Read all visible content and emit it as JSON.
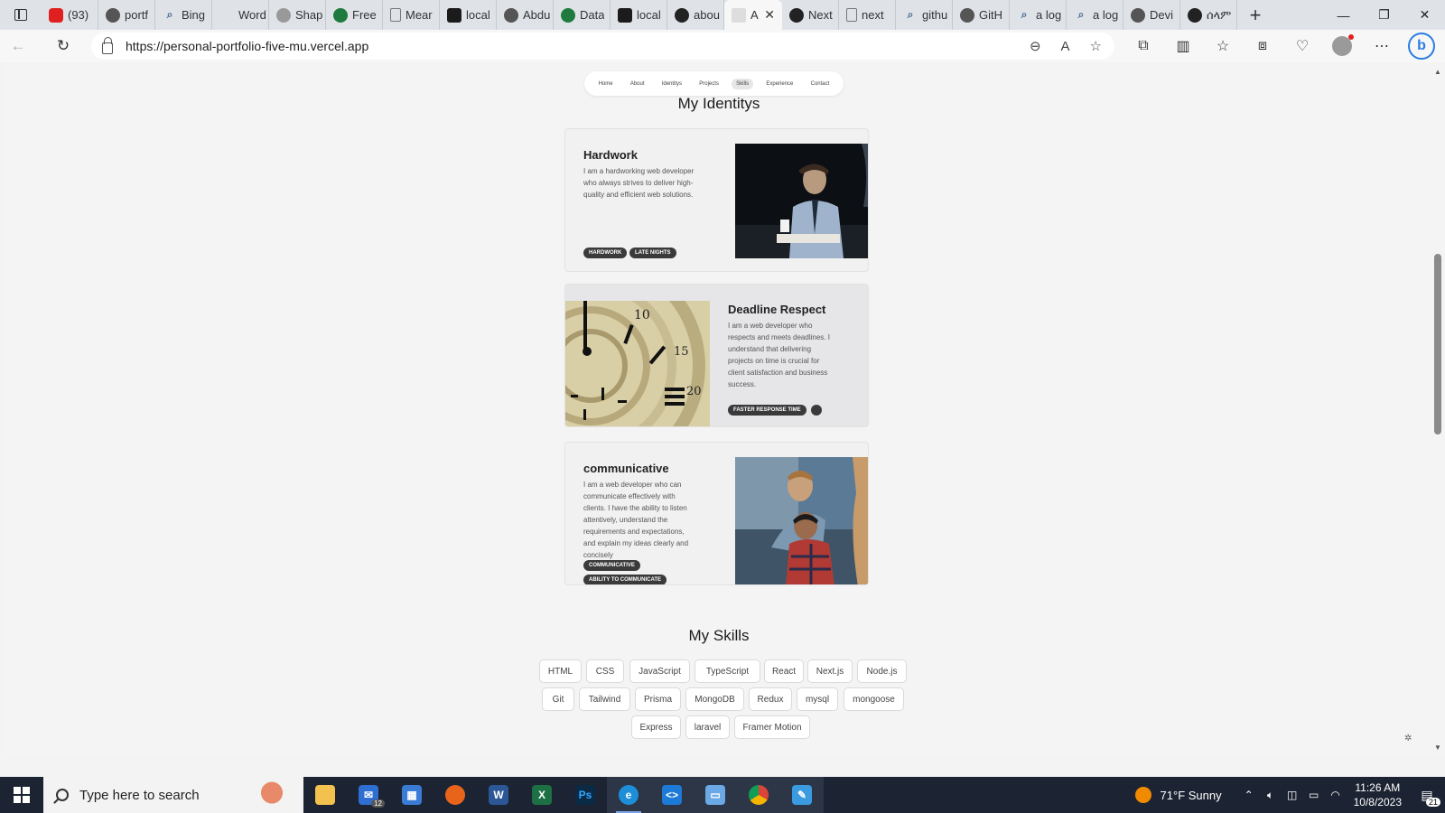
{
  "browser": {
    "tabs": [
      {
        "text": "(93)",
        "icon": "youtube-icon"
      },
      {
        "text": "portf",
        "icon": "github-icon"
      },
      {
        "text": "Bing",
        "icon": "search-icon"
      },
      {
        "text": "Word",
        "icon": "bird-icon"
      },
      {
        "text": "Shap",
        "icon": "cloud-icon"
      },
      {
        "text": "Free",
        "icon": "robot-icon"
      },
      {
        "text": "Mear",
        "icon": "document-icon"
      },
      {
        "text": "local",
        "icon": "page-icon"
      },
      {
        "text": "Abdu",
        "icon": "github-icon"
      },
      {
        "text": "Data",
        "icon": "leaf-icon"
      },
      {
        "text": "local",
        "icon": "page-icon"
      },
      {
        "text": "abou",
        "icon": "vercel-icon"
      },
      {
        "text": "A",
        "icon": "a-icon"
      },
      {
        "text": "Next",
        "icon": "nextjs-icon"
      },
      {
        "text": "next",
        "icon": "document-icon"
      },
      {
        "text": "githu",
        "icon": "search-icon"
      },
      {
        "text": "GitH",
        "icon": "github-icon"
      },
      {
        "text": "a log",
        "icon": "search-icon"
      },
      {
        "text": "a log",
        "icon": "search-icon"
      },
      {
        "text": "Devi",
        "icon": "github-icon"
      },
      {
        "text": "ሰላም",
        "icon": "vercel-icon"
      }
    ],
    "active_tab_index": 12,
    "url": "https://personal-portfolio-five-mu.vercel.app"
  },
  "page": {
    "nav": [
      "Home",
      "About",
      "Identitys",
      "Projects",
      "Skills",
      "Experience",
      "Contact"
    ],
    "active_nav": "Skills",
    "identities_title": "My Identitys",
    "identities": [
      {
        "title": "Hardwork",
        "desc_lines": [
          "I am a hardworking web developer",
          "who always strives to deliver high-",
          "quality and efficient web solutions."
        ],
        "tags": [
          "HARDWORK",
          "LATE NIGHTS"
        ]
      },
      {
        "title": "Deadline Respect",
        "desc_lines": [
          "I am a web developer who",
          "respects and meets deadlines. I",
          "understand that delivering",
          "projects on time is crucial for",
          "client satisfaction and business",
          "success."
        ],
        "tags": [
          "FASTER RESPONSE TIME"
        ]
      },
      {
        "title": "communicative",
        "desc_lines": [
          "I am a web developer who can",
          "communicate effectively with",
          "clients. I have the ability to listen",
          "attentively, understand the",
          "requirements and expectations,",
          "and explain my ideas clearly and",
          "concisely"
        ],
        "tags": [
          "COMMUNICATIVE",
          "ABILITY TO COMMUNICATE"
        ]
      }
    ],
    "skills_title": "My Skills",
    "skills": [
      "HTML",
      "CSS",
      "JavaScript",
      "TypeScript",
      "React",
      "Next.js",
      "Node.js",
      "Git",
      "Tailwind",
      "Prisma",
      "MongoDB",
      "Redux",
      "mysql",
      "mongoose",
      "Express",
      "laravel",
      "Framer Motion"
    ]
  },
  "taskbar": {
    "search_placeholder": "Type here to search",
    "mail_badge": "12",
    "weather": "71°F  Sunny",
    "time": "11:26 AM",
    "date": "10/8/2023",
    "notifications": "21"
  },
  "colors": {
    "tag_bg": "#3a3a3a",
    "taskbar_bg": "#1c2433",
    "accent_blue": "#2a7de1"
  }
}
